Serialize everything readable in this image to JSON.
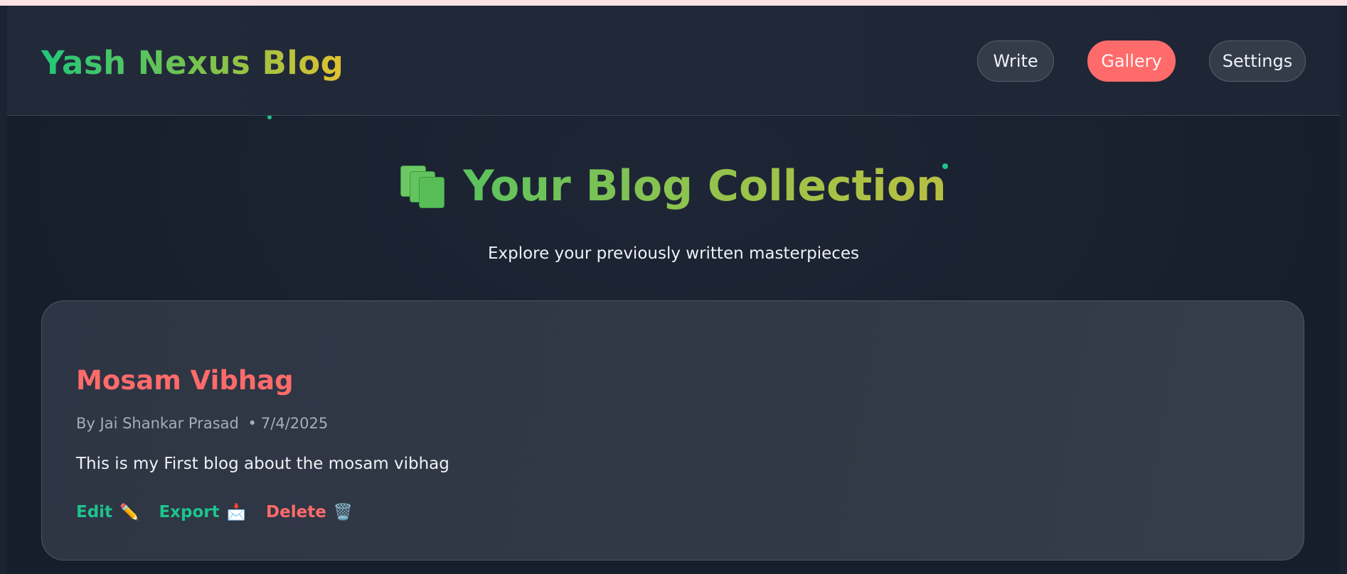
{
  "header": {
    "brand": "Yash Nexus Blog",
    "nav": [
      {
        "label": "Write"
      },
      {
        "label": "Gallery"
      },
      {
        "label": "Settings"
      }
    ]
  },
  "main": {
    "title": "Your Blog Collection",
    "title_icon": "documents-icon",
    "subtitle": "Explore your previously written masterpieces"
  },
  "posts": [
    {
      "title": "Mosam Vibhag",
      "author_prefix": "By",
      "author": "Jai Shankar Prasad",
      "separator": "•",
      "date": "7/4/2025",
      "excerpt": "This is my First blog about the mosam vibhag",
      "actions": {
        "edit": {
          "label": "Edit",
          "icon": "✏️",
          "icon_name": "pencil-icon"
        },
        "export": {
          "label": "Export",
          "icon": "📩",
          "icon_name": "envelope-export-icon"
        },
        "delete": {
          "label": "Delete",
          "icon": "🗑️",
          "icon_name": "wastebasket-icon"
        }
      }
    }
  ],
  "colors": {
    "accent_coral": "#ff6b6b",
    "accent_green": "#1ec38d",
    "background": "#1b2231",
    "card": "#323946"
  }
}
